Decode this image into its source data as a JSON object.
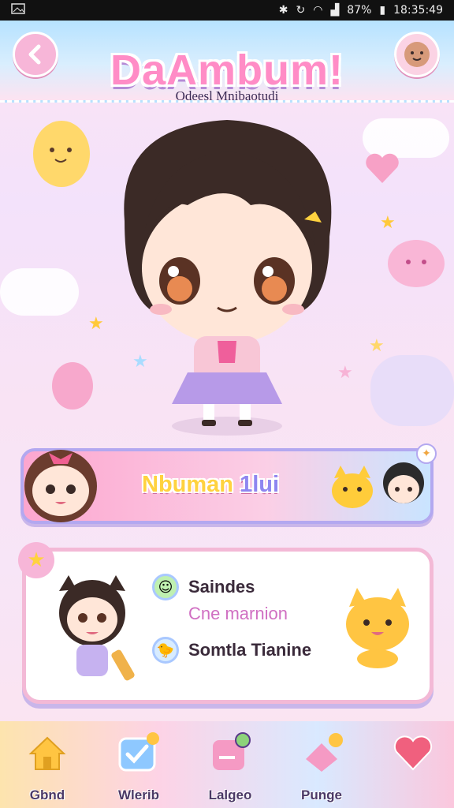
{
  "status_bar": {
    "battery": "87%",
    "time": "18:35:49",
    "icons": [
      "gallery-icon",
      "bluetooth-icon",
      "sync-icon",
      "wifi-icon",
      "signal-icon",
      "battery-icon"
    ]
  },
  "header": {
    "title": "DaAmbum!",
    "subtitle": "Odeesl Mnibaotudi",
    "back_icon": "chevron-left-icon",
    "profile_icon": "cookie-face-icon"
  },
  "banner": {
    "label_main": "Nbuman",
    "label_tail": "1lui"
  },
  "card": {
    "rows": [
      {
        "text": "Saindes",
        "icon": "green-smile-icon",
        "style": "bold"
      },
      {
        "text": "Cne marnion",
        "icon": "",
        "style": "sub"
      },
      {
        "text": "Somtla Tianine",
        "icon": "chick-icon",
        "style": "bold"
      }
    ]
  },
  "nav": {
    "items": [
      {
        "label": "Gbnd",
        "icon": "house-icon"
      },
      {
        "label": "Wlerib",
        "icon": "check-box-icon"
      },
      {
        "label": "Lalgeo",
        "icon": "note-card-icon"
      },
      {
        "label": "Punge",
        "icon": "heart-tag-icon"
      },
      {
        "label": "",
        "icon": "heart-icon"
      }
    ]
  },
  "colors": {
    "accent_pink": "#ff8cc6",
    "banner_text": "#ffd23f",
    "card_border": "#f3b9d6",
    "header_blue": "#b6e2ff"
  }
}
